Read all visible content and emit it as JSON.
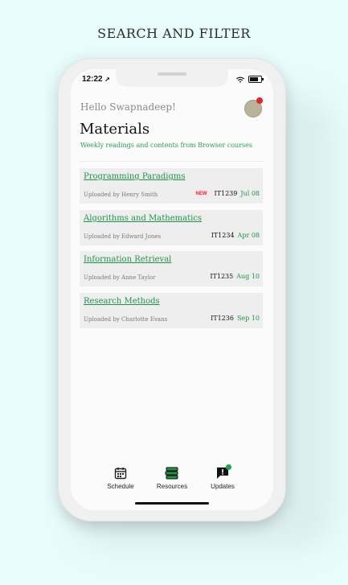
{
  "page_title": "SEARCH AND FILTER",
  "status_bar": {
    "time": "12:22"
  },
  "header": {
    "greeting": "Hello Swapnadeep!",
    "title": "Materials",
    "subtitle": "Weekly readings and contents from Browser courses"
  },
  "materials": [
    {
      "title": "Programming Paradigms",
      "uploader": "Uploaded by Henry Smith",
      "badge": "NEW",
      "code": "IT1239",
      "date": "Jul 08"
    },
    {
      "title": "Algorithms and Mathematics",
      "uploader": "Uploaded by Edward Jones",
      "badge": "",
      "code": "IT1234",
      "date": "Apr 08"
    },
    {
      "title": "Information Retrieval",
      "uploader": "Uploaded by Anne Taylor",
      "badge": "",
      "code": "IT1235",
      "date": "Aug 10"
    },
    {
      "title": "Research Methods",
      "uploader": "Uploaded by Charlotte Evans",
      "badge": "",
      "code": "IT1236",
      "date": "Sep 10"
    }
  ],
  "tabs": [
    {
      "label": "Schedule",
      "icon": "calendar-icon"
    },
    {
      "label": "Resources",
      "icon": "books-icon"
    },
    {
      "label": "Updates",
      "icon": "alert-chat-icon"
    }
  ],
  "colors": {
    "accent": "#1e9447",
    "badge_red": "#e3242b",
    "background": "#e8fcfb"
  }
}
